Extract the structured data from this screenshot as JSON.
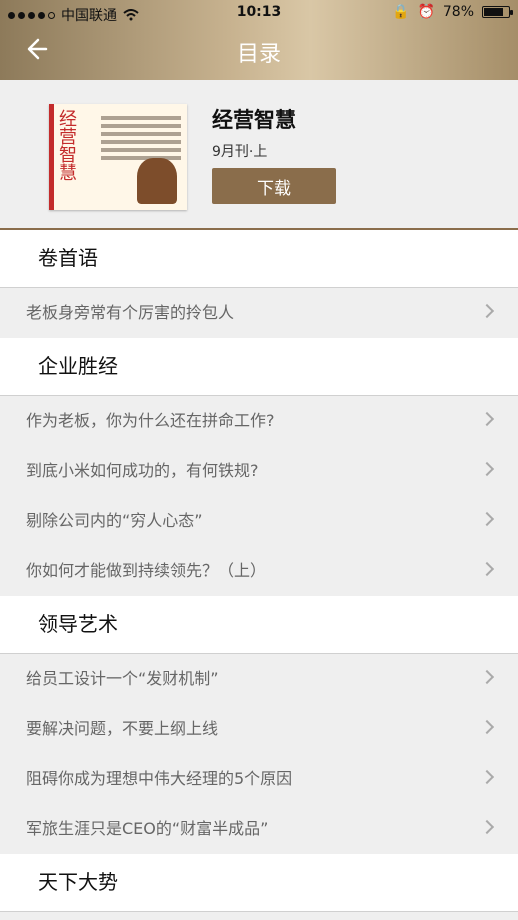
{
  "status_bar": {
    "carrier": "中国联通",
    "time": "10:13",
    "battery_pct": "78%",
    "battery_level": 0.78
  },
  "nav": {
    "title": "目录",
    "back_icon": "back-arrow-icon"
  },
  "book": {
    "cover_title": "经营智慧",
    "name": "经营智慧",
    "issue": "9月刊·上",
    "download_label": "下载"
  },
  "sections": [
    {
      "title": "卷首语",
      "items": [
        "老板身旁常有个厉害的拎包人"
      ]
    },
    {
      "title": "企业胜经",
      "items": [
        "作为老板，你为什么还在拼命工作?",
        "到底小米如何成功的，有何铁规?",
        "剔除公司内的“穷人心态”",
        "你如何才能做到持续领先？（上）"
      ]
    },
    {
      "title": "领导艺术",
      "items": [
        "给员工设计一个“发财机制”",
        "要解决问题，不要上纲上线",
        "阻碍你成为理想中伟大经理的5个原因",
        "军旅生涯只是CEO的“财富半成品”"
      ]
    },
    {
      "title": "天下大势",
      "items": []
    }
  ]
}
